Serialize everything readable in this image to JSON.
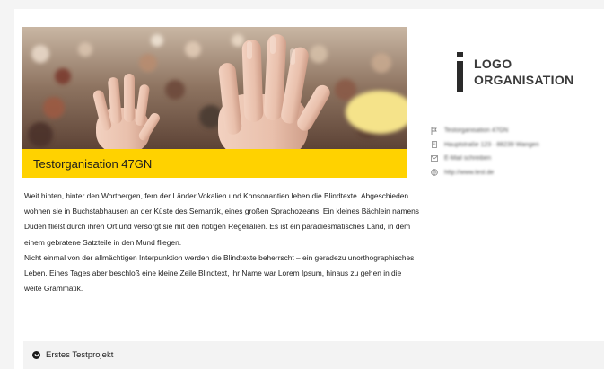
{
  "organization": {
    "name": "Testorganisation 47GN",
    "description": [
      "Weit hinten, hinter den Wortbergen, fern der Länder Vokalien und Konsonantien leben die Blindtexte. Abgeschieden wohnen sie in Buchstabhausen an der Küste des Semantik, eines großen Sprachozeans. Ein kleines Bächlein namens Duden fließt durch ihren Ort und versorgt sie mit den nötigen Regelialien. Es ist ein paradiesmatisches Land, in dem einem gebratene Satzteile in den Mund fliegen.",
      "Nicht einmal von der allmächtigen Interpunktion werden die Blindtexte beherrscht – ein geradezu unorthographisches Leben. Eines Tages aber beschloß eine kleine Zeile Blindtext, ihr Name war Lorem Ipsum, hinaus zu gehen in die weite Grammatik."
    ],
    "banner_color": "#ffd200"
  },
  "logo": {
    "line1": "LOGO",
    "line2": "ORGANISATION"
  },
  "contacts": [
    {
      "icon": "flag-icon",
      "text": "Testorganisation 47GN"
    },
    {
      "icon": "building-icon",
      "text": "Hauptstraße 123 · 88239 Wangen"
    },
    {
      "icon": "envelope-icon",
      "text": "E-Mail schreiben"
    },
    {
      "icon": "globe-icon",
      "text": "http://www.test.de"
    }
  ],
  "projects": [
    {
      "label": "Erstes Testprojekt",
      "icon": "chevron-circle-icon"
    }
  ]
}
